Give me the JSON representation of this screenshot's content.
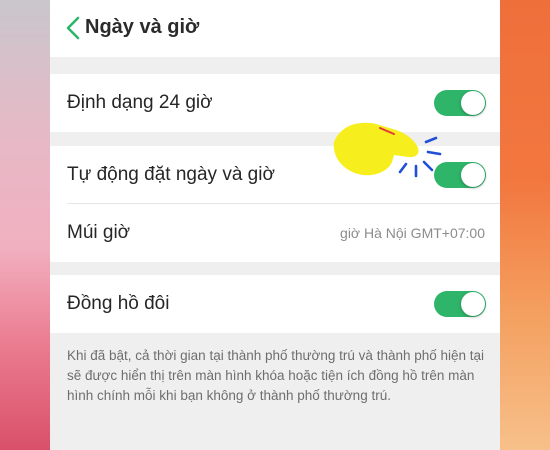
{
  "header": {
    "title": "Ngày và giờ",
    "back_icon": "chevron-left-icon",
    "accent": "#2fb56a"
  },
  "settings": {
    "format_24h": {
      "label": "Định dạng 24 giờ",
      "enabled": true
    },
    "auto_datetime": {
      "label": "Tự động đặt ngày và giờ",
      "enabled": true
    },
    "timezone": {
      "label": "Múi giờ",
      "value": "giờ Hà Nội GMT+07:00"
    },
    "dual_clock": {
      "label": "Đồng hồ đôi",
      "enabled": true
    }
  },
  "dual_clock_description": "Khi đã bật, cả thời gian tại thành phố thường trú và thành phố hiện tại sẽ được hiển thị trên màn hình khóa hoặc tiện ích đồng hồ trên màn hình chính mỗi khi bạn không ở thành phố thường trú.",
  "overlay": {
    "icon": "tap-hand-icon",
    "color": "#f7ee1e"
  }
}
